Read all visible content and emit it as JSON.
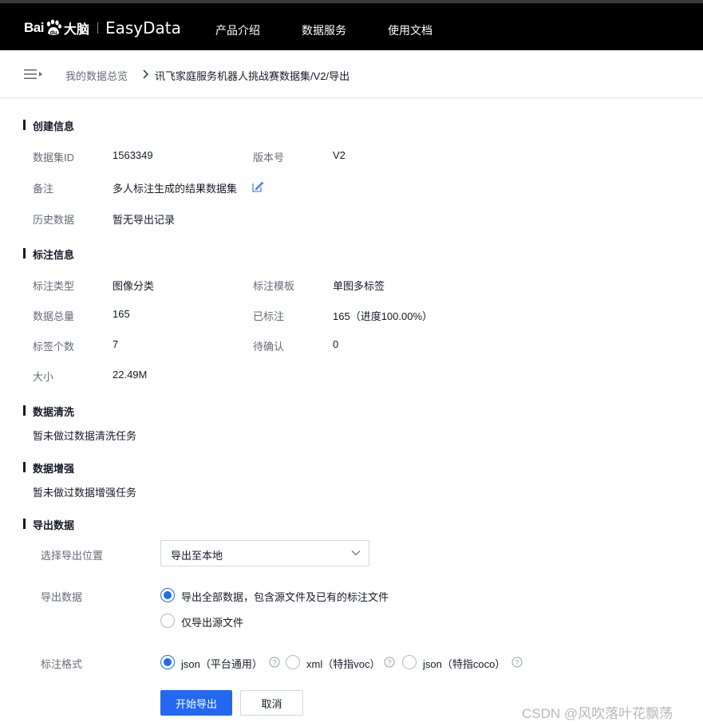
{
  "header": {
    "logo_bai": "Bai",
    "logo_cn": "大脑",
    "logo_product": "EasyData",
    "nav": [
      "产品介绍",
      "数据服务",
      "使用文档"
    ]
  },
  "breadcrumb": {
    "home": "我的数据总览",
    "current": "讯飞家庭服务机器人挑战赛数据集/V2/导出"
  },
  "create_info": {
    "title": "创建信息",
    "dataset_id_label": "数据集ID",
    "dataset_id": "1563349",
    "version_label": "版本号",
    "version": "V2",
    "remark_label": "备注",
    "remark": "多人标注生成的结果数据集",
    "history_label": "历史数据",
    "history": "暂无导出记录"
  },
  "annotation_info": {
    "title": "标注信息",
    "type_label": "标注类型",
    "type": "图像分类",
    "template_label": "标注模板",
    "template": "单图多标签",
    "total_label": "数据总量",
    "total": "165",
    "annotated_label": "已标注",
    "annotated": "165（进度100.00%）",
    "tags_label": "标签个数",
    "tags": "7",
    "pending_label": "待确认",
    "pending": "0",
    "size_label": "大小",
    "size": "22.49M"
  },
  "cleaning": {
    "title": "数据清洗",
    "text": "暂未做过数据清洗任务"
  },
  "augmentation": {
    "title": "数据增强",
    "text": "暂未做过数据增强任务"
  },
  "export": {
    "title": "导出数据",
    "location_label": "选择导出位置",
    "location_value": "导出至本地",
    "data_label": "导出数据",
    "data_options": [
      {
        "label": "导出全部数据，包含源文件及已有的标注文件",
        "selected": true
      },
      {
        "label": "仅导出源文件",
        "selected": false
      }
    ],
    "format_label": "标注格式",
    "format_options": [
      {
        "label": "json（平台通用）",
        "selected": true
      },
      {
        "label": "xml（特指voc）",
        "selected": false
      },
      {
        "label": "json（特指coco）",
        "selected": false
      }
    ],
    "start_button": "开始导出",
    "cancel_button": "取消"
  },
  "watermark": "CSDN @风吹落叶花飘荡",
  "colors": {
    "accent": "#2468f2",
    "nav_bg": "#000000",
    "label": "#666a75",
    "text": "#151a26"
  }
}
